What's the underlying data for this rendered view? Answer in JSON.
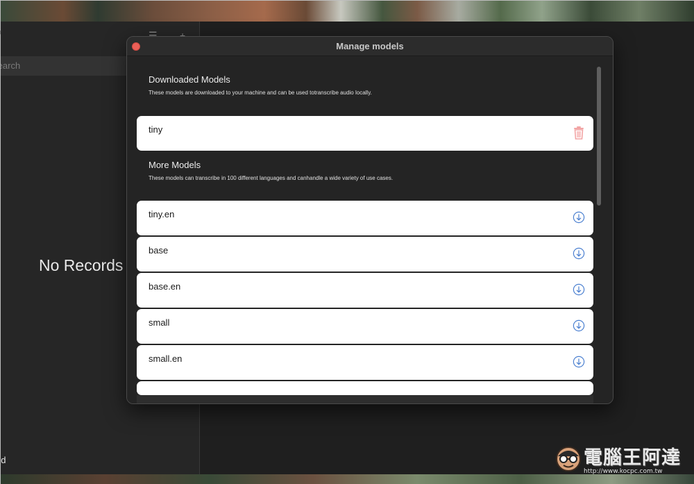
{
  "app": {
    "search_placeholder": "Search",
    "empty_state": "No Records",
    "status_fragment": "ed"
  },
  "modal": {
    "title": "Manage models",
    "downloaded": {
      "title": "Downloaded Models",
      "description": "These models are downloaded to your machine and can be used totranscribe audio locally.",
      "items": [
        {
          "name": "tiny",
          "action_icon": "trash-icon"
        }
      ]
    },
    "more": {
      "title": "More Models",
      "description": "These models can transcribe in 100 different languages and canhandle a wide variety of use cases.",
      "items": [
        {
          "name": "tiny.en",
          "action_icon": "download-icon"
        },
        {
          "name": "base",
          "action_icon": "download-icon"
        },
        {
          "name": "base.en",
          "action_icon": "download-icon"
        },
        {
          "name": "small",
          "action_icon": "download-icon"
        },
        {
          "name": "small.en",
          "action_icon": "download-icon"
        }
      ]
    }
  },
  "watermark": {
    "text": "電腦王阿達",
    "url": "http://www.kocpc.com.tw"
  },
  "colors": {
    "close_button": "#ec5f57",
    "trash_icon": "#f2a4a4",
    "download_icon": "#4a7fd0",
    "card_background": "#ffffff",
    "modal_background": "#242424"
  }
}
